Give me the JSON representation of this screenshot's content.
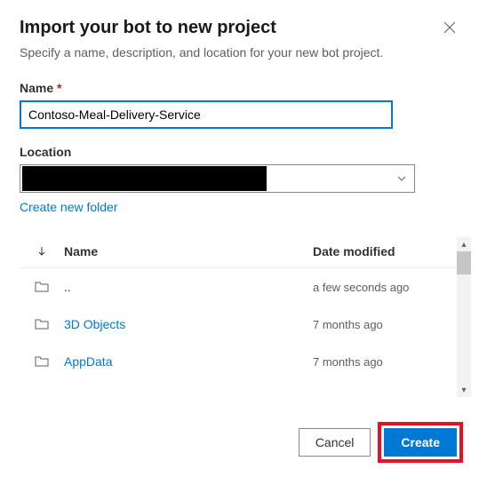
{
  "dialog": {
    "title": "Import your bot to new project",
    "subtitle": "Specify a name, description, and location for your new bot project."
  },
  "nameField": {
    "label": "Name",
    "required": "*",
    "value": "Contoso-Meal-Delivery-Service"
  },
  "locationField": {
    "label": "Location",
    "createFolder": "Create new folder"
  },
  "fileList": {
    "headers": {
      "name": "Name",
      "date": "Date modified"
    },
    "rows": [
      {
        "name": "..",
        "date": "a few seconds ago",
        "link": false
      },
      {
        "name": "3D Objects",
        "date": "7 months ago",
        "link": true
      },
      {
        "name": "AppData",
        "date": "7 months ago",
        "link": true
      }
    ]
  },
  "footer": {
    "cancel": "Cancel",
    "create": "Create"
  }
}
